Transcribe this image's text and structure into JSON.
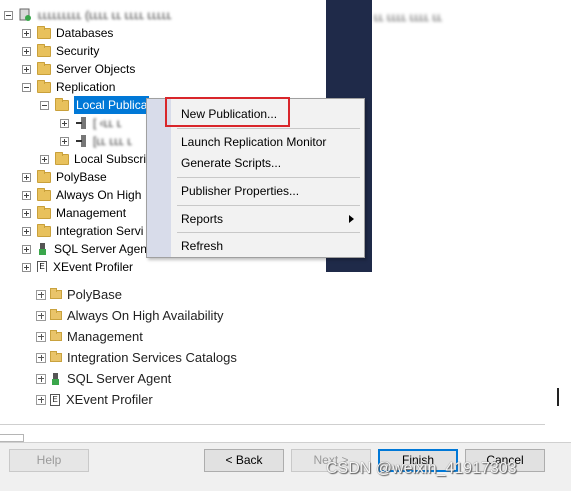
{
  "object_explorer": {
    "server_label": "",
    "items": [
      {
        "label": "Databases"
      },
      {
        "label": "Security"
      },
      {
        "label": "Server Objects"
      },
      {
        "label": "Replication"
      },
      {
        "label": "Local Publica"
      },
      {
        "label": ""
      },
      {
        "label": ""
      },
      {
        "label": "Local Subscri"
      },
      {
        "label": "PolyBase"
      },
      {
        "label": "Always On High"
      },
      {
        "label": "Management"
      },
      {
        "label": "Integration Servi"
      },
      {
        "label": "SQL Server Agen"
      },
      {
        "label": "XEvent Profiler"
      }
    ]
  },
  "context_menu": {
    "items": [
      {
        "label": "New Publication..."
      },
      {
        "label": "Launch Replication Monitor"
      },
      {
        "label": "Generate Scripts..."
      },
      {
        "label": "Publisher Properties..."
      },
      {
        "label": "Reports"
      },
      {
        "label": "Refresh"
      }
    ],
    "highlight_color": "#d9262b"
  },
  "wizard_tree": {
    "items": [
      {
        "label": "PolyBase",
        "icon": "folder-icon"
      },
      {
        "label": "Always On High Availability",
        "icon": "folder-icon"
      },
      {
        "label": "Management",
        "icon": "folder-icon"
      },
      {
        "label": "Integration Services Catalogs",
        "icon": "folder-icon"
      },
      {
        "label": "SQL Server Agent",
        "icon": "agent-icon"
      },
      {
        "label": "XEvent Profiler",
        "icon": "xevent-icon"
      }
    ]
  },
  "footer": {
    "help_label": "Help",
    "back_label": "< Back",
    "next_label": "Next >",
    "finish_label": "Finish",
    "cancel_label": "Cancel"
  },
  "watermark": "CSDN @weixin_41917303",
  "colors": {
    "dark_panel": "#1f2a49",
    "selection": "#0078d7",
    "folder": "#e8c15c"
  }
}
